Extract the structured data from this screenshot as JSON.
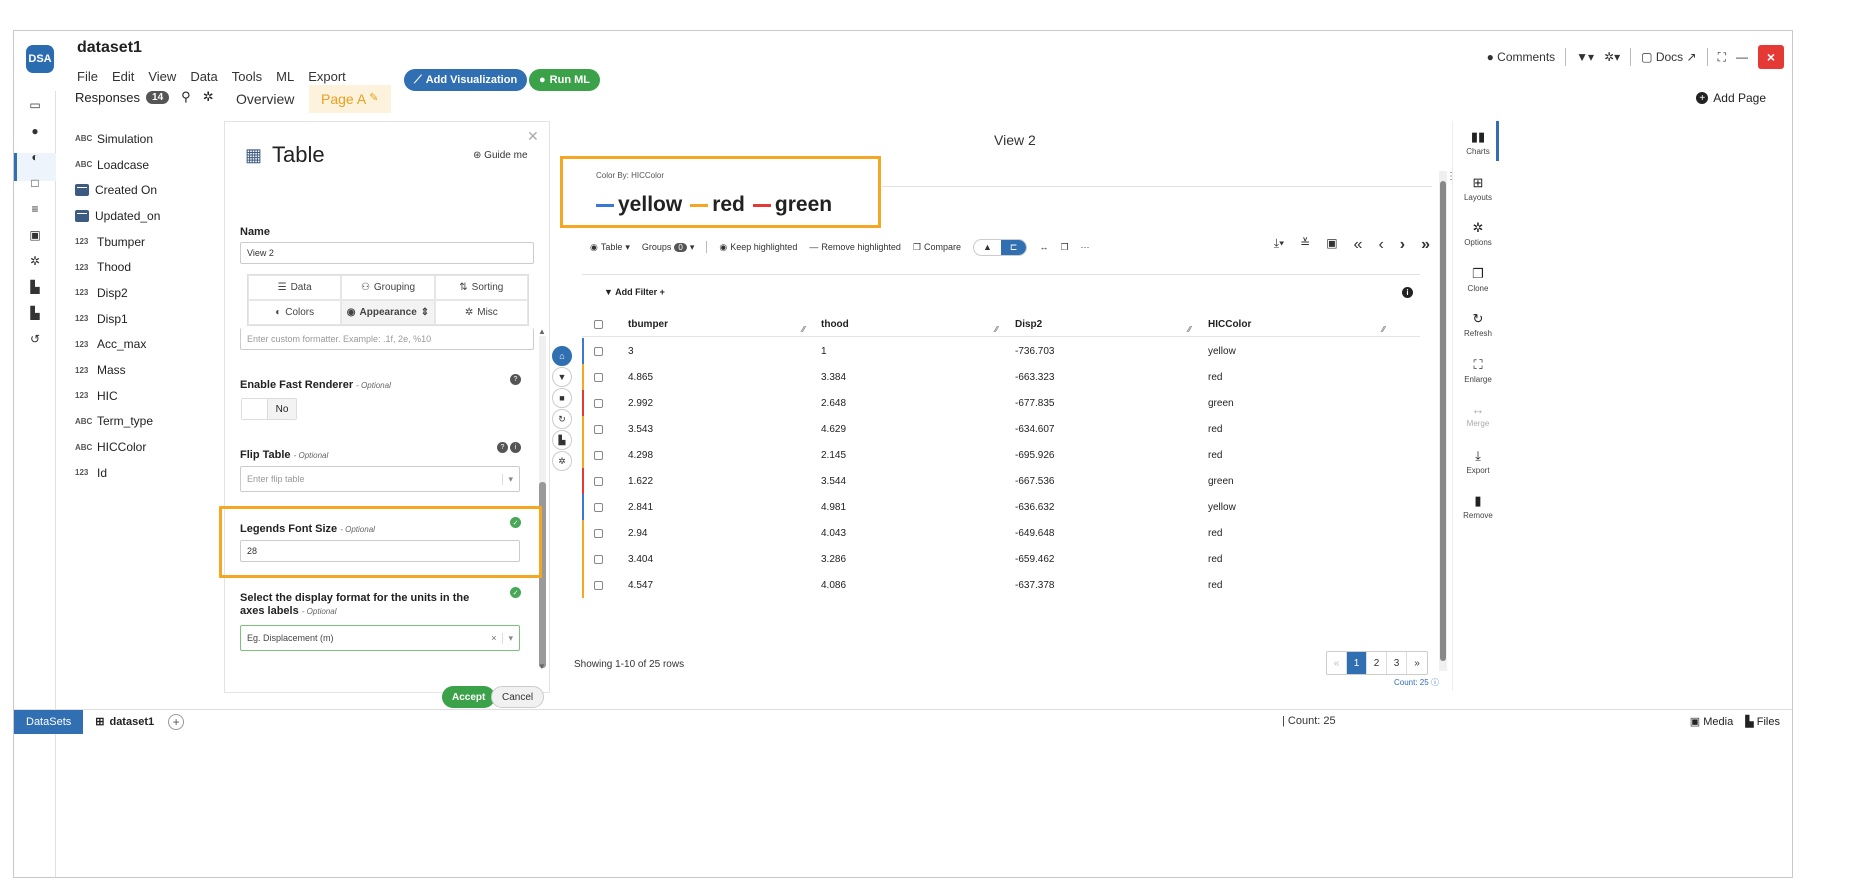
{
  "header": {
    "logo_text": "DSA",
    "dataset_title": "dataset1",
    "menu": [
      "File",
      "Edit",
      "View",
      "Data",
      "Tools",
      "ML",
      "Export"
    ],
    "add_visualization": "Add Visualization",
    "run_ml": "Run ML",
    "comments": "Comments",
    "docs": "Docs"
  },
  "responses": {
    "label": "Responses",
    "count": "14",
    "items": [
      {
        "type": "ABC",
        "name": "Simulation"
      },
      {
        "type": "ABC",
        "name": "Loadcase"
      },
      {
        "type": "date",
        "name": "Created On"
      },
      {
        "type": "date",
        "name": "Updated_on"
      },
      {
        "type": "123",
        "name": "Tbumper"
      },
      {
        "type": "123",
        "name": "Thood"
      },
      {
        "type": "123",
        "name": "Disp2"
      },
      {
        "type": "123",
        "name": "Disp1"
      },
      {
        "type": "123",
        "name": "Acc_max"
      },
      {
        "type": "123",
        "name": "Mass"
      },
      {
        "type": "123",
        "name": "HIC"
      },
      {
        "type": "ABC",
        "name": "Term_type"
      },
      {
        "type": "ABC",
        "name": "HICColor"
      },
      {
        "type": "123",
        "name": "Id"
      }
    ]
  },
  "tabs": {
    "overview": "Overview",
    "page_a": "Page A",
    "add_page": "Add Page"
  },
  "config": {
    "title": "Table",
    "guide_me": "Guide me",
    "name_label": "Name",
    "name_value": "View 2",
    "tabs": [
      "Data",
      "Grouping",
      "Sorting",
      "Colors",
      "Appearance",
      "Misc"
    ],
    "custom_formatter_placeholder": "Enter custom formatter.  Example: .1f, 2e, %10",
    "fast_renderer_label": "Enable Fast Renderer",
    "fast_renderer_value": "No",
    "flip_table_label": "Flip Table",
    "flip_table_placeholder": "Enter flip table",
    "legends_font_label": "Legends Font Size",
    "legends_font_value": "28",
    "units_format_label": "Select the display format for the units in the axes labels",
    "units_format_placeholder": "Eg. Displacement (m)",
    "optional": "- Optional",
    "accept": "Accept",
    "cancel": "Cancel"
  },
  "view": {
    "title": "View 2",
    "color_by": "Color By: HICColor",
    "legend": [
      {
        "label": "yellow",
        "color": "#3a78d6"
      },
      {
        "label": "red",
        "color": "#f5a623"
      },
      {
        "label": "green",
        "color": "#e53935"
      }
    ],
    "toolbar": {
      "table": "Table",
      "groups": "Groups",
      "groups_count": "0",
      "keep_highlighted": "Keep highlighted",
      "remove_highlighted": "Remove highlighted",
      "compare": "Compare"
    },
    "add_filter": "Add Filter",
    "columns": [
      "tbumper",
      "thood",
      "Disp2",
      "HICColor"
    ],
    "rows": [
      {
        "strip": "#3a78d6",
        "cells": [
          "3",
          "1",
          "-736.703",
          "yellow"
        ]
      },
      {
        "strip": "#f5a623",
        "cells": [
          "4.865",
          "3.384",
          "-663.323",
          "red"
        ]
      },
      {
        "strip": "#e53935",
        "cells": [
          "2.992",
          "2.648",
          "-677.835",
          "green"
        ]
      },
      {
        "strip": "#f5a623",
        "cells": [
          "3.543",
          "4.629",
          "-634.607",
          "red"
        ]
      },
      {
        "strip": "#f5a623",
        "cells": [
          "4.298",
          "2.145",
          "-695.926",
          "red"
        ]
      },
      {
        "strip": "#e53935",
        "cells": [
          "1.622",
          "3.544",
          "-667.536",
          "green"
        ]
      },
      {
        "strip": "#3a78d6",
        "cells": [
          "2.841",
          "4.981",
          "-636.632",
          "yellow"
        ]
      },
      {
        "strip": "#f5a623",
        "cells": [
          "2.94",
          "4.043",
          "-649.648",
          "red"
        ]
      },
      {
        "strip": "#f5a623",
        "cells": [
          "3.404",
          "3.286",
          "-659.462",
          "red"
        ]
      },
      {
        "strip": "#f5a623",
        "cells": [
          "4.547",
          "4.086",
          "-637.378",
          "red"
        ]
      }
    ],
    "showing": "Showing 1-10 of 25 rows",
    "pages": [
      "«",
      "1",
      "2",
      "3",
      "»"
    ],
    "count_badge": "Count: 25"
  },
  "right_sidebar": [
    "Charts",
    "Layouts",
    "Options",
    "Clone",
    "Refresh",
    "Enlarge",
    "Merge",
    "Export",
    "Remove"
  ],
  "status": {
    "datasets": "DataSets",
    "dataset1": "dataset1",
    "count": "Count: 25",
    "media": "Media",
    "files": "Files"
  }
}
